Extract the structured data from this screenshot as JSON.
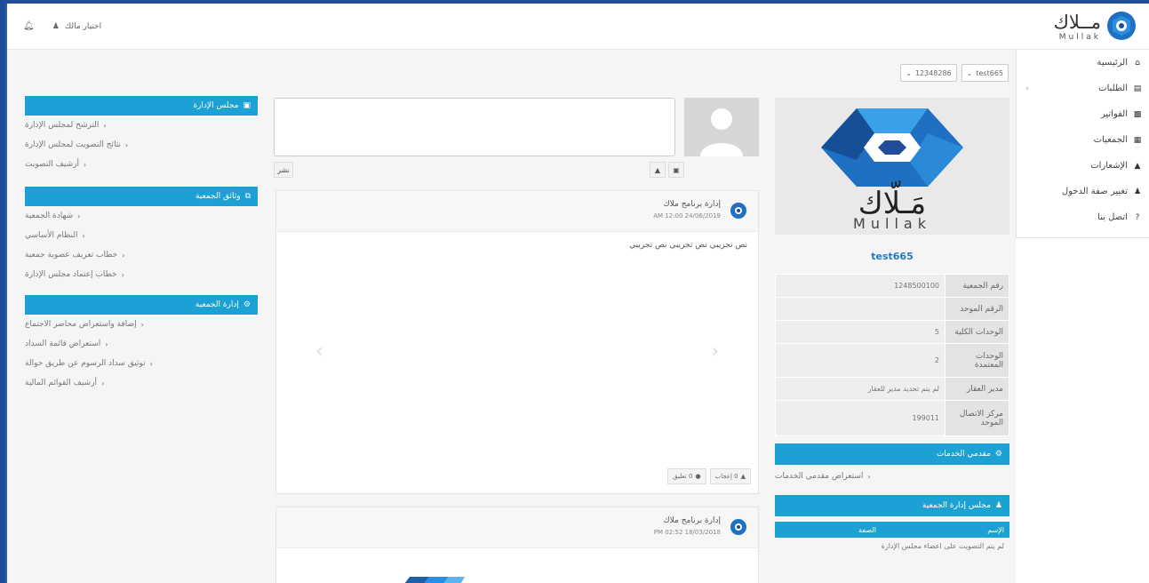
{
  "brand": {
    "logo_ar": "مــلاك",
    "logo_en": "Mullak"
  },
  "header": {
    "username": "اختيار مالك"
  },
  "sidebar": {
    "items": [
      {
        "label": "الرئيسية",
        "icon": "home-icon"
      },
      {
        "label": "الطلبات",
        "icon": "document-icon",
        "has_arrow": true
      },
      {
        "label": "الفواتير",
        "icon": "invoice-icon"
      },
      {
        "label": "الجمعيات",
        "icon": "building-icon"
      },
      {
        "label": "الإشعارات",
        "icon": "bell-icon"
      },
      {
        "label": "تغيير صفة الدخول",
        "icon": "user-icon"
      },
      {
        "label": "اتصل بنا",
        "icon": "help-icon"
      }
    ]
  },
  "selectors": {
    "association": "test665",
    "unit": "12348286"
  },
  "left_panels": [
    {
      "title": "مجلس الإدارة",
      "icon": "id-card-icon",
      "items": [
        "الترشح لمجلس الإدارة",
        "نتائج التصويت لمجلس الإدارة",
        "أرشيف التصويت"
      ]
    },
    {
      "title": "وثائق الجمعية",
      "icon": "copy-icon",
      "items": [
        "شهادة الجمعية",
        "النظام الأساسي",
        "خطاب تعريف عضوية جمعية",
        "خطاب إعتماد مجلس الإدارة"
      ]
    },
    {
      "title": "إدارة الجمعية",
      "icon": "cogs-icon",
      "items": [
        "إضافة واستعراض محاضر الاجتماع",
        "استعراض قائمة السداد",
        "توثيق سداد الرسوم عن طريق حوالة",
        "أرشيف القوائم المالية"
      ]
    }
  ],
  "composer": {
    "publish_label": "نشر"
  },
  "posts": [
    {
      "author": "إدارة برنامج ملاك",
      "date": "AM 12:00 24/06/2019",
      "body": "نص تجريبي نص تجريبي نص تجريبي",
      "like_label": "0 إعجاب",
      "comment_label": "0 تعليق"
    },
    {
      "author": "إدارة برنامج ملاك",
      "date": "PM 02:52 18/03/2018"
    }
  ],
  "profile": {
    "logo_ar": "مَـلّاك",
    "logo_en": "Mullak",
    "name": "test665",
    "rows": [
      {
        "label": "رقم الجمعية",
        "value": "1248500100"
      },
      {
        "label": "الرقم الموحد",
        "value": ""
      },
      {
        "label": "الوحدات الكلية",
        "value": "5"
      },
      {
        "label": "الوحدات المعتمدة",
        "value": "2"
      },
      {
        "label": "مدير العقار",
        "value": "لم يتم تحديد مدير للعقار"
      },
      {
        "label": "مركز الاتصال الموحد",
        "value": "199011"
      }
    ],
    "services_title": "مقدمي الخدمات",
    "services_item": "استعراض مقدمي الخدمات",
    "board_title": "مجلس إدارة الجمعية",
    "board_col_name": "الإسم",
    "board_col_role": "الصفة",
    "board_note": "لم يتم التصويت على اعضاء مجلس الإدارة"
  },
  "colors": {
    "accent": "#1ba1d4",
    "frame": "#1f4d9a",
    "link": "#2278c2"
  }
}
